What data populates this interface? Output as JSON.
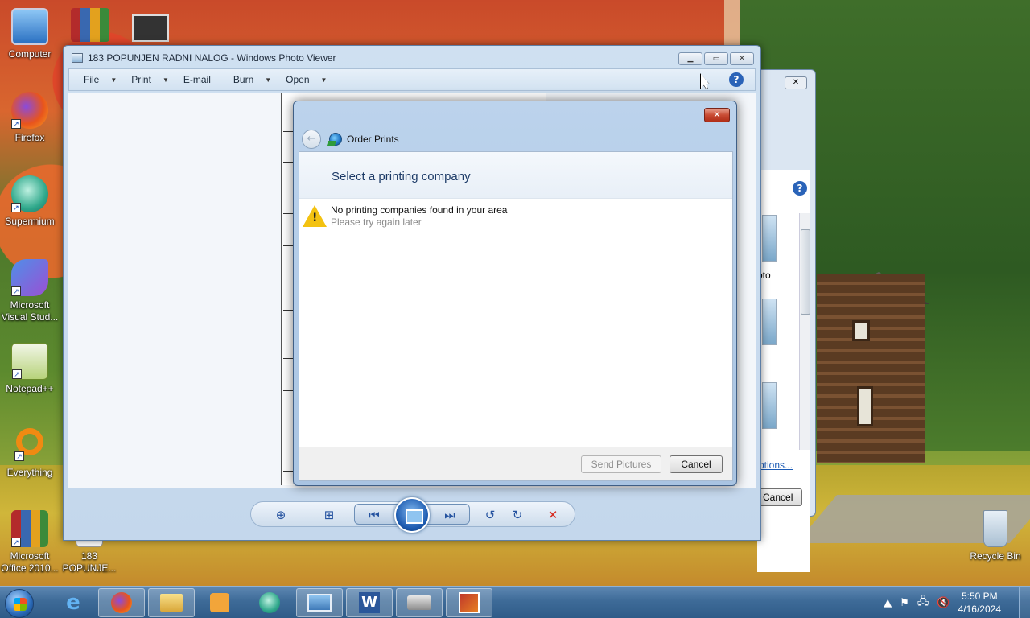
{
  "desktop": {
    "icons": [
      {
        "label": "Computer",
        "icon": "computer-icon"
      },
      {
        "label": "Firefox",
        "icon": "firefox-icon"
      },
      {
        "label": "Supermium",
        "icon": "supermium-icon"
      },
      {
        "label": "Microsoft Visual Stud...",
        "icon": "visual-studio-icon"
      },
      {
        "label": "Notepad++",
        "icon": "notepad-plus-plus-icon"
      },
      {
        "label": "Everything",
        "icon": "everything-icon"
      },
      {
        "label": "Microsoft Office 2010...",
        "icon": "office-icon"
      },
      {
        "label": "183 POPUNJE...",
        "icon": "document-file-icon"
      },
      {
        "label": "Recycle Bin",
        "icon": "recycle-bin-icon"
      }
    ]
  },
  "photo_viewer": {
    "title": "183 POPUNJEN RADNI NALOG - Windows Photo Viewer",
    "menu": [
      "File",
      "Print",
      "E-mail",
      "Burn",
      "Open"
    ],
    "controls": [
      "zoom-icon",
      "fit-window-icon",
      "previous-icon",
      "slideshow-icon",
      "next-icon",
      "rotate-counterclockwise-icon",
      "rotate-clockwise-icon",
      "delete-icon"
    ]
  },
  "background_window": {
    "photo_label": "oto",
    "link_label": "ptions...",
    "cancel_label": "Cancel"
  },
  "dialog": {
    "title": "Order Prints",
    "instruction": "Select a printing company",
    "message_main": "No printing companies found in your area",
    "message_sub": "Please try again later",
    "send_button": "Send Pictures",
    "cancel_button": "Cancel"
  },
  "taskbar": {
    "apps": [
      "internet-explorer-icon",
      "firefox-icon",
      "file-explorer-icon",
      "media-player-icon",
      "supermium-icon",
      "photo-viewer-icon",
      "word-icon",
      "scanner-icon",
      "office-picture-icon"
    ],
    "active_app": "photo-viewer-icon",
    "time": "5:50 PM",
    "date": "4/16/2024"
  },
  "colors": {
    "accent": "#2a63b8",
    "dialog_instruction": "#1d3b67",
    "warning": "#f3c211",
    "close_red": "#c94c34"
  }
}
